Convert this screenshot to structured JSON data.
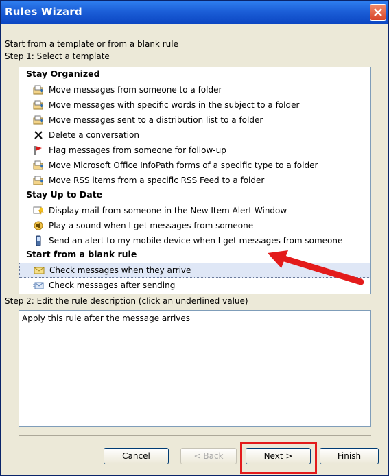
{
  "window": {
    "title": "Rules Wizard"
  },
  "labels": {
    "intro": "Start from a template or from a blank rule",
    "step1": "Step 1: Select a template",
    "step2": "Step 2: Edit the rule description (click an underlined value)"
  },
  "groups": [
    {
      "name": "Stay Organized",
      "items": [
        {
          "label": "Move messages from someone to a folder",
          "icon": "move-folder-icon"
        },
        {
          "label": "Move messages with specific words in the subject to a folder",
          "icon": "move-folder-icon"
        },
        {
          "label": "Move messages sent to a distribution list to a folder",
          "icon": "move-folder-icon"
        },
        {
          "label": "Delete a conversation",
          "icon": "delete-x-icon"
        },
        {
          "label": "Flag messages from someone for follow-up",
          "icon": "red-flag-icon"
        },
        {
          "label": "Move Microsoft Office InfoPath forms of a specific type to a folder",
          "icon": "move-folder-icon"
        },
        {
          "label": "Move RSS items from a specific RSS Feed to a folder",
          "icon": "move-folder-icon"
        }
      ]
    },
    {
      "name": "Stay Up to Date",
      "items": [
        {
          "label": "Display mail from someone in the New Item Alert Window",
          "icon": "alert-window-icon"
        },
        {
          "label": "Play a sound when I get messages from someone",
          "icon": "speaker-icon"
        },
        {
          "label": "Send an alert to my mobile device when I get messages from someone",
          "icon": "mobile-device-icon"
        }
      ]
    },
    {
      "name": "Start from a blank rule",
      "items": [
        {
          "label": "Check messages when they arrive",
          "icon": "envelope-icon",
          "selected": true
        },
        {
          "label": "Check messages after sending",
          "icon": "sent-mail-icon"
        }
      ]
    }
  ],
  "description": {
    "text": "Apply this rule after the message arrives"
  },
  "buttons": {
    "cancel": "Cancel",
    "back": "< Back",
    "next": "Next >",
    "finish": "Finish"
  },
  "colors": {
    "highlight": "#e31b1b",
    "selection": "#dfe7f6",
    "titlebar": "#1c5fd8"
  }
}
